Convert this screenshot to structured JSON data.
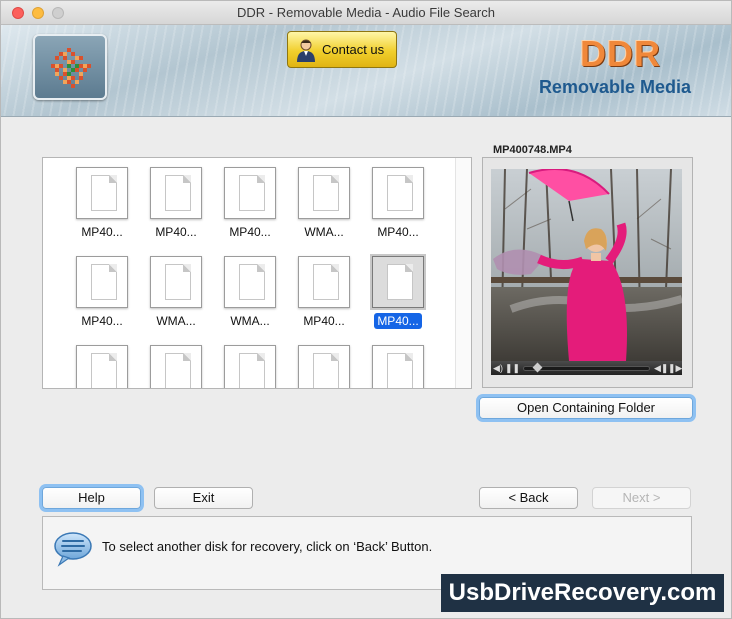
{
  "window": {
    "title": "DDR - Removable Media - Audio File Search"
  },
  "header": {
    "contact_label": "Contact us",
    "brand_title": "DDR",
    "brand_subtitle": "Removable Media"
  },
  "files": [
    {
      "name": "MP40...",
      "selected": false
    },
    {
      "name": "MP40...",
      "selected": false
    },
    {
      "name": "MP40...",
      "selected": false
    },
    {
      "name": "WMA...",
      "selected": false
    },
    {
      "name": "MP40...",
      "selected": false
    },
    {
      "name": "MP40...",
      "selected": false
    },
    {
      "name": "WMA...",
      "selected": false
    },
    {
      "name": "WMA...",
      "selected": false
    },
    {
      "name": "MP40...",
      "selected": false
    },
    {
      "name": "MP40...",
      "selected": true
    },
    {
      "name": "",
      "selected": false
    },
    {
      "name": "",
      "selected": false
    },
    {
      "name": "",
      "selected": false
    },
    {
      "name": "",
      "selected": false
    },
    {
      "name": "",
      "selected": false
    }
  ],
  "preview": {
    "title": "MP400748.MP4",
    "open_folder_label": "Open Containing Folder"
  },
  "buttons": {
    "help": "Help",
    "exit": "Exit",
    "back": "< Back",
    "next": "Next >"
  },
  "status": {
    "message": "To select another disk for recovery, click on ‘Back’ Button."
  },
  "watermark": "UsbDriveRecovery.com",
  "colors": {
    "selection": "#1565e6",
    "brand_orange": "#f0883a",
    "brand_blue": "#1f5a8f",
    "contact_gold": "#f1cf2c"
  }
}
